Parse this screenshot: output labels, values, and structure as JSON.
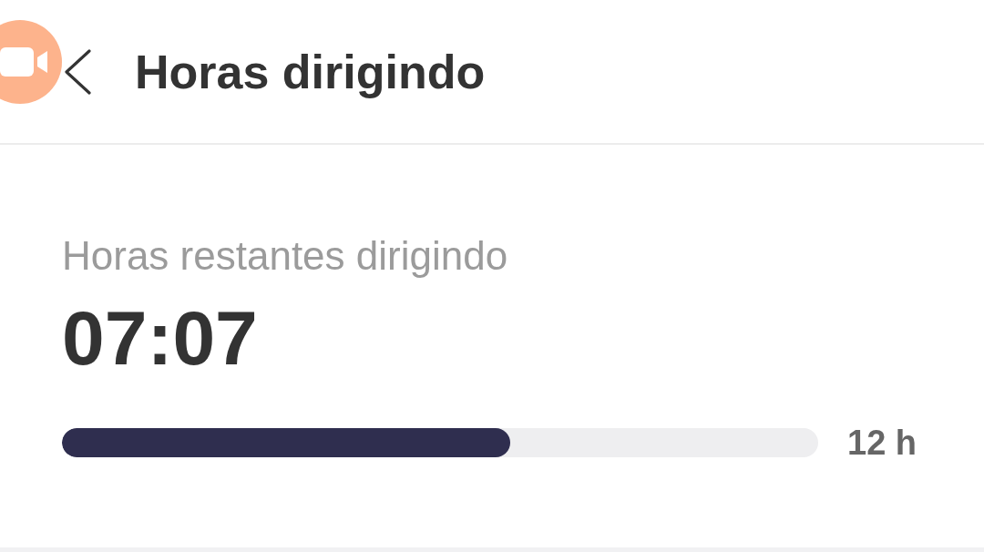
{
  "header": {
    "title": "Horas dirigindo"
  },
  "remaining": {
    "label": "Horas restantes dirigindo",
    "value": "07:07",
    "level": 0.593,
    "max_label": "12 h"
  }
}
